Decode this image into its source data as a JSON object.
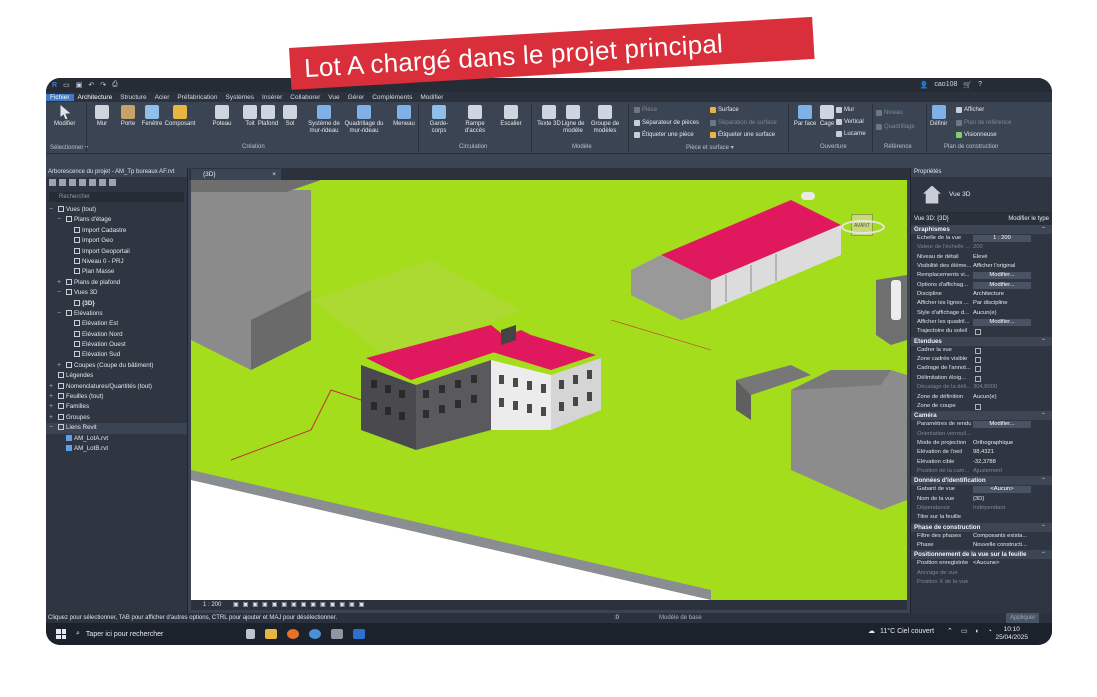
{
  "banner": "Lot A chargé dans le projet principal",
  "qat": {
    "user": "cao108"
  },
  "tabs": [
    "Fichier",
    "Architecture",
    "Structure",
    "Acier",
    "Préfabrication",
    "Systèmes",
    "Insérer",
    "Collaborer",
    "Vue",
    "Gérer",
    "Compléments",
    "Modifier"
  ],
  "ribbon": {
    "modifier": "Modifier",
    "selectionner": "Sélectionner",
    "construction": [
      "Mur",
      "Porte",
      "Fenêtre",
      "Composant",
      "Poteau",
      "Toit",
      "Plafond",
      "Sol",
      "Système de mur-rideau",
      "Quadrillage du mur-rideau",
      "Meneau"
    ],
    "creation": "Création",
    "circulation_items": [
      "Garde-corps",
      "Rampe d'accès",
      "Escalier"
    ],
    "circulation": "Circulation",
    "modele_items": [
      "Texte 3D",
      "Ligne de modèle",
      "Groupe de modèles"
    ],
    "modele": "Modèle",
    "piece": [
      "Pièce",
      "Séparateur de pièces",
      "Étiqueter une pièce"
    ],
    "surface": [
      "Surface",
      "Séparation de surface",
      "Étiqueter une surface"
    ],
    "piece_surface": "Pièce et surface",
    "ouverture_items": [
      "Par face",
      "Cage",
      "Mur",
      "Vertical",
      "Lucarne"
    ],
    "ouverture": "Ouverture",
    "reference_items": [
      "Niveau",
      "Quadrillage"
    ],
    "reference": "Référence",
    "plan_items": [
      "Définir",
      "Afficher",
      "Plan de référence",
      "Visionneuse"
    ],
    "plan": "Plan de construction"
  },
  "browser": {
    "title": "Arborescence du projet - AM_Tp bureaux AF.rvt",
    "search": "Rechercher",
    "nodes": [
      {
        "label": "Vues (tout)",
        "level": 0,
        "tog": "−"
      },
      {
        "label": "Plans d'étage",
        "level": 1,
        "tog": "−"
      },
      {
        "label": "Import Cadastre",
        "level": 2
      },
      {
        "label": "Import Geo",
        "level": 2
      },
      {
        "label": "Import Geoportail",
        "level": 2
      },
      {
        "label": "Niveau 0 - PRJ",
        "level": 2
      },
      {
        "label": "Plan Masse",
        "level": 2
      },
      {
        "label": "Plans de plafond",
        "level": 1,
        "tog": "+"
      },
      {
        "label": "Vues 3D",
        "level": 1,
        "tog": "−"
      },
      {
        "label": "{3D}",
        "level": 2,
        "bold": true
      },
      {
        "label": "Elévations",
        "level": 1,
        "tog": "−"
      },
      {
        "label": "Elévation Est",
        "level": 2
      },
      {
        "label": "Elévation Nord",
        "level": 2
      },
      {
        "label": "Elévation Ouest",
        "level": 2
      },
      {
        "label": "Elévation Sud",
        "level": 2
      },
      {
        "label": "Coupes (Coupe du bâtiment)",
        "level": 1,
        "tog": "+"
      },
      {
        "label": "Légendes",
        "level": 0
      },
      {
        "label": "Nomenclatures/Quantités (tout)",
        "level": 0,
        "tog": "+"
      },
      {
        "label": "Feuilles (tout)",
        "level": 0,
        "tog": "+"
      },
      {
        "label": "Familles",
        "level": 0,
        "tog": "+"
      },
      {
        "label": "Groupes",
        "level": 0,
        "tog": "+"
      },
      {
        "label": "Liens Revit",
        "level": 0,
        "tog": "−",
        "sel": true
      },
      {
        "label": "AM_LotA.rvt",
        "level": 1,
        "link": true
      },
      {
        "label": "AM_LotB.rvt",
        "level": 1,
        "link": true
      }
    ]
  },
  "view": {
    "tab": "{3D}",
    "scale": "1 : 200",
    "cube_label": "AVANT"
  },
  "props": {
    "title": "Propriétés",
    "type": "Vue 3D",
    "selector": "Vue 3D: {3D}",
    "edit_type": "Modifier le type",
    "apply": "Appliquer",
    "sections": [
      {
        "title": "Graphismes",
        "rows": [
          {
            "k": "Echelle de la vue",
            "v": "1 : 200",
            "box": true
          },
          {
            "k": "Valeur de l'échelle ...",
            "v": "200",
            "dim": true
          },
          {
            "k": "Niveau de détail",
            "v": "Elevé"
          },
          {
            "k": "Visibilité des éléme...",
            "v": "Afficher l'original"
          },
          {
            "k": "Remplacements vi...",
            "v": "Modifier...",
            "box": true
          },
          {
            "k": "Options d'affichag...",
            "v": "Modifier...",
            "box": true
          },
          {
            "k": "Discipline",
            "v": "Architecture"
          },
          {
            "k": "Afficher les lignes ...",
            "v": "Par discipline"
          },
          {
            "k": "Style d'affichage d...",
            "v": "Aucun(e)"
          },
          {
            "k": "Afficher les quadril...",
            "v": "Modifier...",
            "box": true
          },
          {
            "k": "Trajectoire du soleil",
            "v": "",
            "cb": true
          }
        ]
      },
      {
        "title": "Etendues",
        "rows": [
          {
            "k": "Cadrer la vue",
            "v": "",
            "cb": true
          },
          {
            "k": "Zone cadrée visible",
            "v": "",
            "cb": true
          },
          {
            "k": "Cadrage de l'annot...",
            "v": "",
            "cb": true
          },
          {
            "k": "Délimitation éloig...",
            "v": "",
            "cb": true
          },
          {
            "k": "Décalage de la déli...",
            "v": "304,8000",
            "dim": true
          },
          {
            "k": "Zone de définition",
            "v": "Aucun(e)"
          },
          {
            "k": "Zone de coupe",
            "v": "",
            "cb": true
          }
        ]
      },
      {
        "title": "Caméra",
        "rows": [
          {
            "k": "Paramètres de rendu",
            "v": "Modifier...",
            "box": true
          },
          {
            "k": "Orientation verrouil...",
            "v": "",
            "dim": true
          },
          {
            "k": "Mode de projection",
            "v": "Orthographique"
          },
          {
            "k": "Elévation de l'oeil",
            "v": "98,4321"
          },
          {
            "k": "Elévation cible",
            "v": "-32,3788"
          },
          {
            "k": "Position de la cam...",
            "v": "Ajustement",
            "dim": true
          }
        ]
      },
      {
        "title": "Données d'identification",
        "rows": [
          {
            "k": "Gabarit de vue",
            "v": "<Aucun>",
            "box": true
          },
          {
            "k": "Nom de la vue",
            "v": "{3D}"
          },
          {
            "k": "Dépendance",
            "v": "Indépendant",
            "dim": true
          },
          {
            "k": "Titre sur la feuille",
            "v": ""
          }
        ]
      },
      {
        "title": "Phase de construction",
        "rows": [
          {
            "k": "Filtre des phases",
            "v": "Composants exista..."
          },
          {
            "k": "Phase",
            "v": "Nouvelle constructi..."
          }
        ]
      },
      {
        "title": "Positionnement de la vue sur la feuille",
        "rows": [
          {
            "k": "Position enregistrée",
            "v": "<Aucune>"
          },
          {
            "k": "Ancrage de vue",
            "v": "",
            "dim": true
          },
          {
            "k": "Position X de la vue",
            "v": "",
            "dim": true
          }
        ]
      }
    ]
  },
  "status": {
    "text": "Cliquez pour sélectionner, TAB pour afficher d'autres options, CTRL pour ajouter et MAJ pour désélectionner.",
    "model": "Modèle de base",
    "zero": ":0"
  },
  "taskbar": {
    "search": "Taper ici pour rechercher",
    "weather": "11°C  Ciel couvert",
    "time": "10:10",
    "date": "25/04/2025"
  },
  "colors": {
    "ground": "#a4dd1c",
    "roof": "#e0185e",
    "accent": "#3d7ac7",
    "banner": "#d92f3a"
  }
}
